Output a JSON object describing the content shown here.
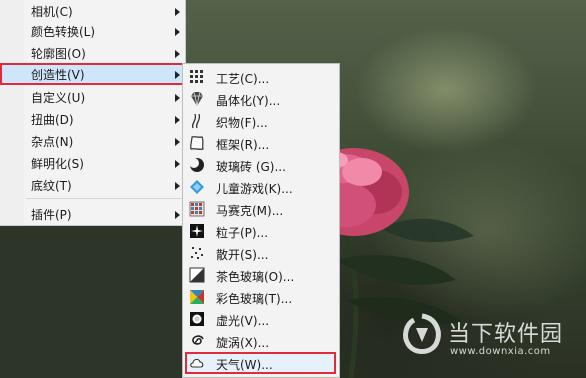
{
  "main_menu": {
    "items": [
      {
        "label": "相机(C)",
        "has_submenu": true
      },
      {
        "label": "颜色转换(L)",
        "has_submenu": true
      },
      {
        "label": "轮廓图(O)",
        "has_submenu": true
      },
      {
        "label": "创造性(V)",
        "has_submenu": true,
        "selected": true
      },
      {
        "label": "自定义(U)",
        "has_submenu": true
      },
      {
        "label": "扭曲(D)",
        "has_submenu": true
      },
      {
        "label": "杂点(N)",
        "has_submenu": true
      },
      {
        "label": "鲜明化(S)",
        "has_submenu": true
      },
      {
        "label": "底纹(T)",
        "has_submenu": true
      },
      {
        "label": "插件(P)",
        "has_submenu": true
      }
    ]
  },
  "submenu": {
    "items": [
      {
        "label": "工艺(C)...",
        "icon": "crafts-icon"
      },
      {
        "label": "晶体化(Y)...",
        "icon": "crystalize-icon"
      },
      {
        "label": "织物(F)...",
        "icon": "fabric-icon"
      },
      {
        "label": "框架(R)...",
        "icon": "frame-icon"
      },
      {
        "label": "玻璃砖 (G)...",
        "icon": "glass-block-icon"
      },
      {
        "label": "儿童游戏(K)...",
        "icon": "kids-play-icon"
      },
      {
        "label": "马赛克(M)...",
        "icon": "mosaic-icon"
      },
      {
        "label": "粒子(P)...",
        "icon": "particles-icon"
      },
      {
        "label": "散开(S)...",
        "icon": "scatter-icon"
      },
      {
        "label": "茶色玻璃(O)...",
        "icon": "smoked-glass-icon"
      },
      {
        "label": "彩色玻璃(T)...",
        "icon": "stained-glass-icon"
      },
      {
        "label": "虚光(V)...",
        "icon": "vignette-icon"
      },
      {
        "label": "旋涡(X)...",
        "icon": "vortex-icon"
      },
      {
        "label": "天气(W)...",
        "icon": "weather-icon",
        "selected": true
      }
    ]
  },
  "watermark": {
    "name": "当下软件园",
    "url": "www.downxia.com"
  },
  "colors": {
    "highlight_border": "#e02b3a",
    "selected_fill": "#cfe6fa",
    "menu_bg": "#f3f3f3"
  }
}
